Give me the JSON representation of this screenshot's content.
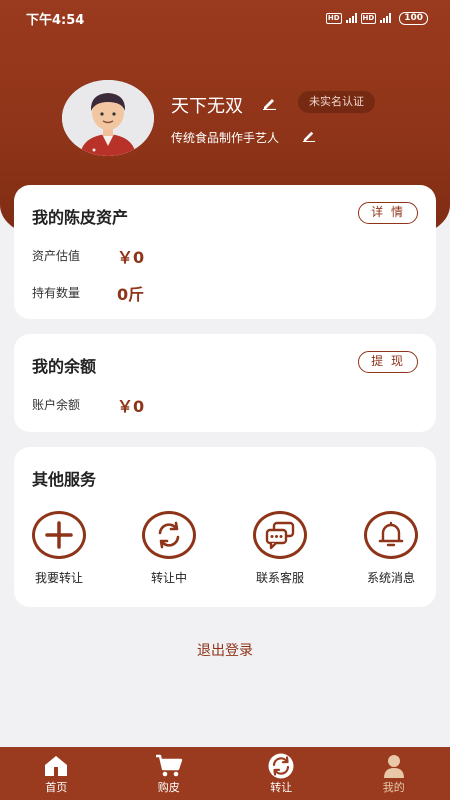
{
  "status_bar": {
    "time": "下午4:54",
    "battery": "100"
  },
  "profile": {
    "name": "天下无双",
    "auth_status": "未实名认证",
    "bio": "传统食品制作手艺人"
  },
  "assets_card": {
    "title": "我的陈皮资产",
    "detail_button": "详 情",
    "rows": [
      {
        "label": "资产估值",
        "value": "￥0"
      },
      {
        "label": "持有数量",
        "value": "0斤"
      }
    ]
  },
  "balance_card": {
    "title": "我的余额",
    "withdraw_button": "提 现",
    "label": "账户余额",
    "value": "￥0"
  },
  "services_card": {
    "title": "其他服务",
    "items": [
      {
        "label": "我要转让",
        "icon": "plus-icon"
      },
      {
        "label": "转让中",
        "icon": "refresh-icon"
      },
      {
        "label": "联系客服",
        "icon": "chat-icon"
      },
      {
        "label": "系统消息",
        "icon": "bell-icon"
      }
    ]
  },
  "logout_label": "退出登录",
  "tabs": [
    {
      "label": "首页",
      "icon": "home-icon"
    },
    {
      "label": "购皮",
      "icon": "cart-icon"
    },
    {
      "label": "转让",
      "icon": "transfer-icon"
    },
    {
      "label": "我的",
      "icon": "user-icon"
    }
  ],
  "colors": {
    "brand": "#9a3a1e",
    "accent": "#8e3418",
    "active_tab": "#e8c8a6",
    "background": "#f1f1f4"
  }
}
